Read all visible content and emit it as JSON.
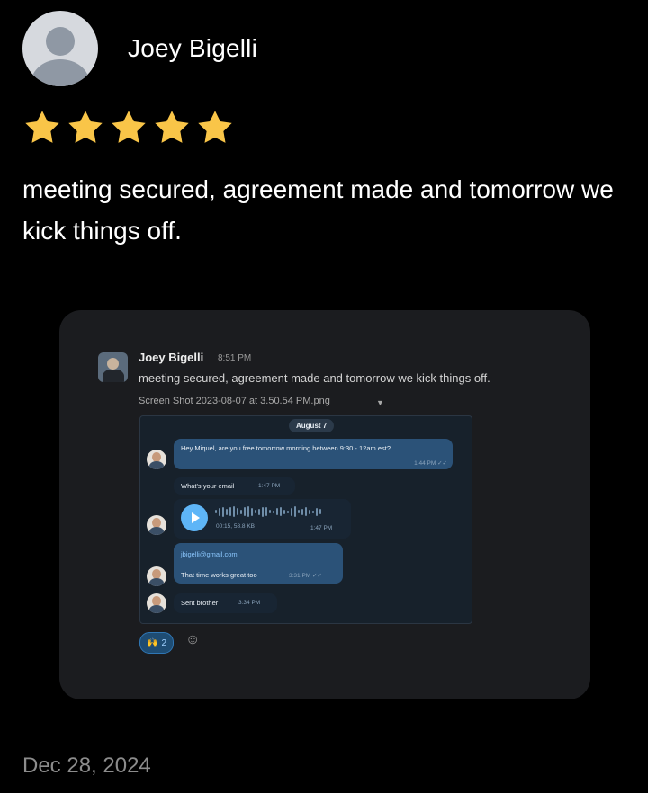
{
  "review": {
    "author": "Joey Bigelli",
    "rating": 5,
    "text": "meeting secured, agreement made and tomorrow we kick things off.",
    "date": "Dec 28, 2024"
  },
  "screenshot": {
    "message": {
      "author": "Joey Bigelli",
      "time": "8:51 PM",
      "text": "meeting secured, agreement made and tomorrow we kick things off.",
      "file": "Screen Shot 2023-08-07 at 3.50.54 PM.png"
    },
    "chat": {
      "date": "August 7",
      "messages": [
        {
          "text": "Hey Miquel, are you free tomorrow morning between 9:30 - 12am est?",
          "time": "1:44 PM"
        },
        {
          "text": "What's your email",
          "time": "1:47 PM"
        },
        {
          "voice_meta": "00:15, 58.8 KB",
          "time": "1:47 PM"
        },
        {
          "text": "jbigelli@gmail.com",
          "time": ""
        },
        {
          "text": "That time works great too",
          "time": "3:31 PM"
        },
        {
          "text": "Sent brother",
          "time": "3:34 PM"
        }
      ]
    },
    "reaction_count": "2"
  },
  "colors": {
    "star": "#F9C548",
    "background": "#000000",
    "card": "#1B1C1F",
    "telegram_outgoing": "#2B5278",
    "telegram_incoming": "#182533"
  }
}
